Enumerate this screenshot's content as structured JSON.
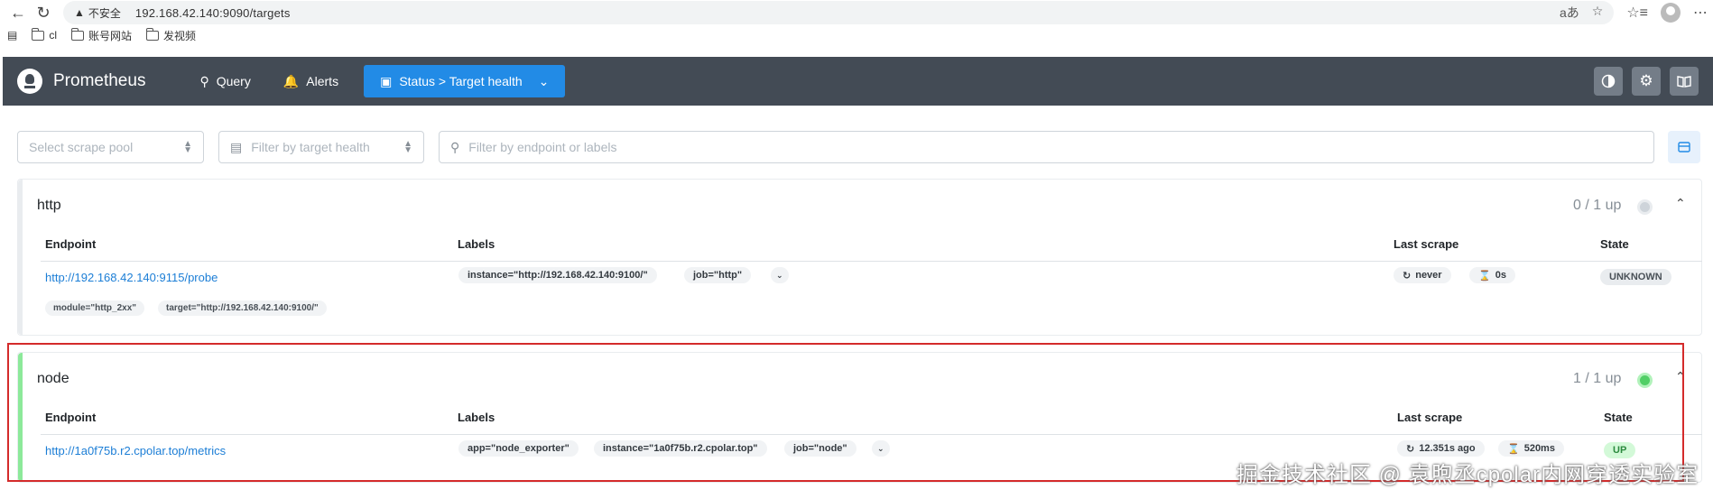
{
  "browser": {
    "insecure_label": "不安全",
    "url": "192.168.42.140:9090/targets",
    "translate_icon": "translate-icon",
    "bookmarks": [
      {
        "label": "cl"
      },
      {
        "label": "账号网站"
      },
      {
        "label": "发视频"
      }
    ]
  },
  "header": {
    "brand": "Prometheus",
    "nav": {
      "query": "Query",
      "alerts": "Alerts",
      "status": "Status > Target health"
    }
  },
  "filters": {
    "scrape_pool_placeholder": "Select scrape pool",
    "health_placeholder": "Filter by target health",
    "endpoint_placeholder": "Filter by endpoint or labels"
  },
  "columns": {
    "endpoint": "Endpoint",
    "labels": "Labels",
    "last_scrape": "Last scrape",
    "state": "State"
  },
  "pools": [
    {
      "name": "http",
      "up_count": "0 / 1 up",
      "health_color": "#ced4da",
      "target": {
        "endpoint": "http://192.168.42.140:9115/probe",
        "labels": [
          "instance=\"http://192.168.42.140:9100/\"",
          "job=\"http\""
        ],
        "params": [
          "module=\"http_2xx\"",
          "target=\"http://192.168.42.140:9100/\""
        ],
        "last_scrape": "never",
        "duration": "0s",
        "state": "UNKNOWN",
        "state_color": "#495057",
        "state_bg": "#e9ecef"
      }
    },
    {
      "name": "node",
      "up_count": "1 / 1 up",
      "health_color": "#51cf66",
      "target": {
        "endpoint": "http://1a0f75b.r2.cpolar.top/metrics",
        "labels": [
          "app=\"node_exporter\"",
          "instance=\"1a0f75b.r2.cpolar.top\"",
          "job=\"node\""
        ],
        "last_scrape": "12.351s ago",
        "duration": "520ms",
        "state": "UP",
        "state_color": "#2b8a3e",
        "state_bg": "#d3f9d8"
      }
    }
  ],
  "watermark": "掘金技术社区 @ 袁煦丞cpolar内网穿透实验室"
}
